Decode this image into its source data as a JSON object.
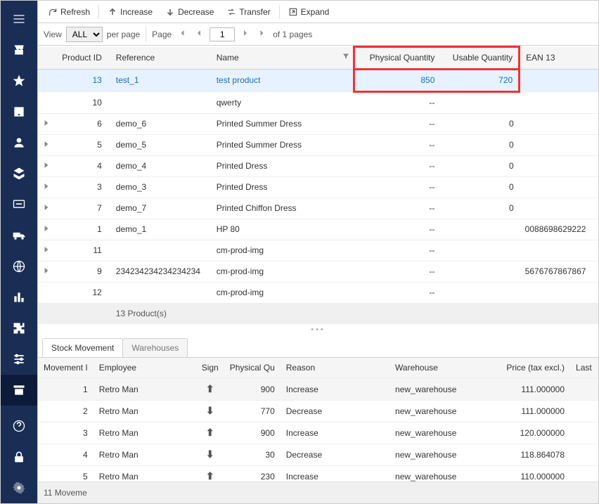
{
  "toolbar": {
    "refresh": "Refresh",
    "increase": "Increase",
    "decrease": "Decrease",
    "transfer": "Transfer",
    "expand": "Expand"
  },
  "pager": {
    "view": "View",
    "all": "ALL",
    "per_page": "per page",
    "page": "Page",
    "current": "1",
    "of": "of 1 pages"
  },
  "table": {
    "headers": {
      "product_id": "Product ID",
      "reference": "Reference",
      "name": "Name",
      "physical": "Physical Quantity",
      "usable": "Usable Quantity",
      "ean": "EAN 13"
    },
    "rows": [
      {
        "exp": "",
        "pid": "13",
        "ref": "test_1",
        "name": "test product",
        "pq": "850",
        "uq": "720",
        "ean": "",
        "sel": true
      },
      {
        "exp": "",
        "pid": "10",
        "ref": "",
        "name": "qwerty",
        "pq": "--",
        "uq": "",
        "ean": ""
      },
      {
        "exp": ">",
        "pid": "6",
        "ref": "demo_6",
        "name": "Printed Summer Dress",
        "pq": "--",
        "uq": "0",
        "ean": ""
      },
      {
        "exp": ">",
        "pid": "5",
        "ref": "demo_5",
        "name": "Printed Summer Dress",
        "pq": "--",
        "uq": "0",
        "ean": ""
      },
      {
        "exp": ">",
        "pid": "4",
        "ref": "demo_4",
        "name": "Printed Dress",
        "pq": "--",
        "uq": "0",
        "ean": ""
      },
      {
        "exp": ">",
        "pid": "3",
        "ref": "demo_3",
        "name": "Printed Dress",
        "pq": "--",
        "uq": "0",
        "ean": ""
      },
      {
        "exp": ">",
        "pid": "7",
        "ref": "demo_7",
        "name": "Printed Chiffon Dress",
        "pq": "--",
        "uq": "0",
        "ean": ""
      },
      {
        "exp": ">",
        "pid": "1",
        "ref": "demo_1",
        "name": "HP 80",
        "pq": "--",
        "uq": "",
        "ean": "0088698629222"
      },
      {
        "exp": ">",
        "pid": "11",
        "ref": "",
        "name": "cm-prod-img",
        "pq": "--",
        "uq": "",
        "ean": ""
      },
      {
        "exp": ">",
        "pid": "9",
        "ref": "234234234234234234",
        "name": "cm-prod-img",
        "pq": "--",
        "uq": "",
        "ean": "5676767867867"
      },
      {
        "exp": "",
        "pid": "12",
        "ref": "",
        "name": "cm-prod-img",
        "pq": "--",
        "uq": "",
        "ean": ""
      }
    ],
    "footer": "13 Product(s)"
  },
  "tabs": {
    "stock_movement": "Stock Movement",
    "warehouses": "Warehouses"
  },
  "movement": {
    "headers": {
      "mid": "Movement I",
      "employee": "Employee",
      "sign": "Sign",
      "physical": "Physical Qu",
      "reason": "Reason",
      "warehouse": "Warehouse",
      "price": "Price (tax excl.)",
      "last": "Last"
    },
    "rows": [
      {
        "mid": "1",
        "emp": "Retro Man",
        "sign": "up",
        "pq": "900",
        "reason": "Increase",
        "wh": "new_warehouse",
        "price": "111.000000"
      },
      {
        "mid": "2",
        "emp": "Retro Man",
        "sign": "down",
        "pq": "770",
        "reason": "Decrease",
        "wh": "new_warehouse",
        "price": "111.000000"
      },
      {
        "mid": "3",
        "emp": "Retro Man",
        "sign": "up",
        "pq": "900",
        "reason": "Increase",
        "wh": "new_warehouse",
        "price": "120.000000"
      },
      {
        "mid": "4",
        "emp": "Retro Man",
        "sign": "down",
        "pq": "30",
        "reason": "Decrease",
        "wh": "new_warehouse",
        "price": "118.864078"
      },
      {
        "mid": "5",
        "emp": "Retro Man",
        "sign": "up",
        "pq": "230",
        "reason": "Increase",
        "wh": "new_warehouse",
        "price": "110.000000"
      }
    ],
    "footer": "11 Moveme"
  }
}
